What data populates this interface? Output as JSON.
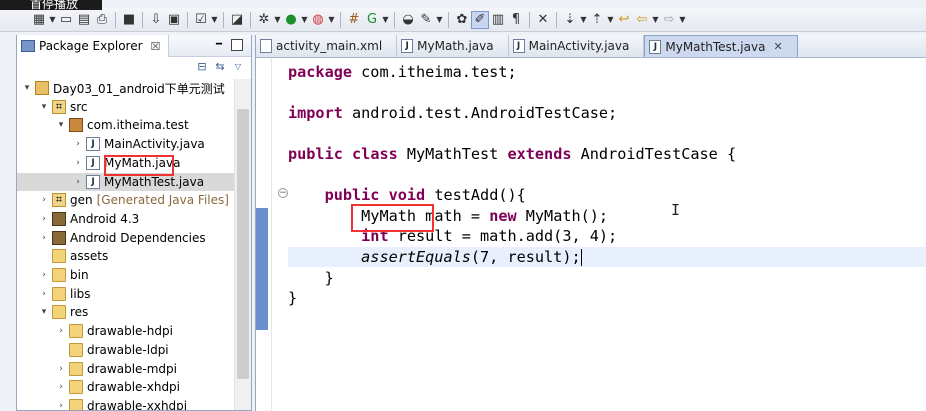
{
  "overlay": {
    "caption": "首停播放"
  },
  "toolbar": {
    "icons": [
      "new-icon",
      "save-icon",
      "save-all-icon",
      "print-icon",
      "build-icon",
      "debug-config-icon",
      "android-sdk-icon",
      "checkbox-task-icon",
      "new-android-project-icon",
      "debug-icon",
      "run-icon",
      "external-tools-icon",
      "new-java-package-icon",
      "new-java-class-icon",
      "open-type-icon",
      "search-icon",
      "annotation-icon",
      "toggle-mark-icon",
      "block-select-icon",
      "show-whitespace-icon",
      "pin-icon",
      "next-annotation-icon",
      "prev-annotation-icon",
      "last-edit-icon",
      "back-icon",
      "forward-icon"
    ]
  },
  "explorer": {
    "title": "Package Explorer",
    "close": "☒",
    "tree": [
      {
        "label": "Day03_01_android下单元测试",
        "depth": 0,
        "twist": "▾",
        "icon": "project"
      },
      {
        "label": "src",
        "depth": 1,
        "twist": "▾",
        "icon": "source-folder"
      },
      {
        "label": "com.itheima.test",
        "depth": 2,
        "twist": "▾",
        "icon": "package"
      },
      {
        "label": "MainActivity.java",
        "depth": 3,
        "twist": "›",
        "icon": "java-file"
      },
      {
        "label": "MyMath.java",
        "depth": 3,
        "twist": "›",
        "icon": "java-file"
      },
      {
        "label": "MyMathTest.java",
        "depth": 3,
        "twist": "›",
        "icon": "java-file",
        "selected": true
      },
      {
        "label": "gen",
        "sub": "[Generated Java Files]",
        "depth": 1,
        "twist": "›",
        "icon": "source-folder"
      },
      {
        "label": "Android 4.3",
        "depth": 1,
        "twist": "›",
        "icon": "library"
      },
      {
        "label": "Android Dependencies",
        "depth": 1,
        "twist": "›",
        "icon": "library"
      },
      {
        "label": "assets",
        "depth": 1,
        "twist": "",
        "icon": "folder"
      },
      {
        "label": "bin",
        "depth": 1,
        "twist": "›",
        "icon": "folder"
      },
      {
        "label": "libs",
        "depth": 1,
        "twist": "›",
        "icon": "folder"
      },
      {
        "label": "res",
        "depth": 1,
        "twist": "▾",
        "icon": "folder"
      },
      {
        "label": "drawable-hdpi",
        "depth": 2,
        "twist": "›",
        "icon": "folder"
      },
      {
        "label": "drawable-ldpi",
        "depth": 2,
        "twist": "",
        "icon": "folder"
      },
      {
        "label": "drawable-mdpi",
        "depth": 2,
        "twist": "›",
        "icon": "folder"
      },
      {
        "label": "drawable-xhdpi",
        "depth": 2,
        "twist": "›",
        "icon": "folder"
      },
      {
        "label": "drawable-xxhdpi",
        "depth": 2,
        "twist": "›",
        "icon": "folder"
      }
    ]
  },
  "editor": {
    "tabs": [
      {
        "label": "activity_main.xml",
        "active": false
      },
      {
        "label": "MyMath.java",
        "active": false
      },
      {
        "label": "MainActivity.java",
        "active": false
      },
      {
        "label": "MyMathTest.java",
        "active": true
      }
    ],
    "code": {
      "l1_kw": "package",
      "l1_rest": " com.itheima.test;",
      "l3_kw": "import",
      "l3_rest": " android.test.AndroidTestCase;",
      "l5_kw1": "public",
      "l5_kw2": "class",
      "l5_name": " MyMathTest ",
      "l5_kw3": "extends",
      "l5_rest": " AndroidTestCase {",
      "l7_kw1": "public",
      "l7_kw2": "void",
      "l7_rest": " testAdd(){",
      "l8_type": "MyMath",
      "l8_mid": " math = ",
      "l8_kw": "new",
      "l8_rest": " MyMath();",
      "l9_kw": "int",
      "l9_rest": " result = math.add(3, 4);",
      "l10_it": "assertEquals",
      "l10_rest": "(7, result);",
      "l11": "}",
      "l12": "}"
    }
  }
}
